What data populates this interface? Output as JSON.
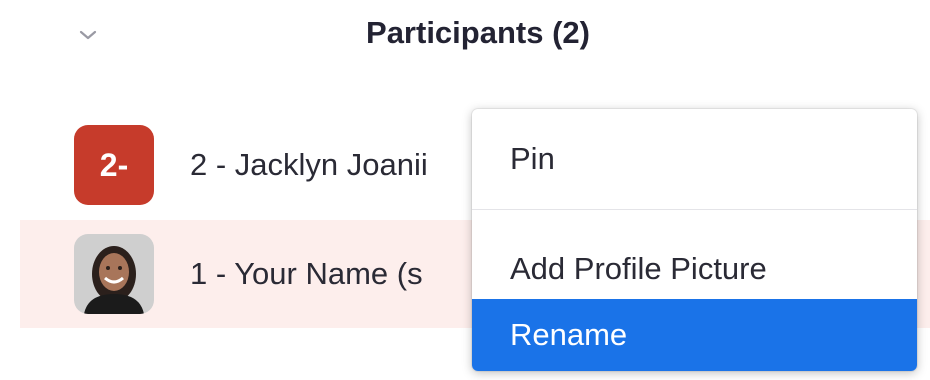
{
  "header": {
    "title": "Participants (2)",
    "collapse_icon": "chevron-down-icon"
  },
  "participants": [
    {
      "display_name": "2 - Jacklyn Joanii",
      "avatar_initials": "2-",
      "avatar_color": "#c63b2b"
    },
    {
      "display_name": "1 - Your Name (s",
      "avatar_icon": "person-photo-icon"
    }
  ],
  "context_menu": {
    "items": [
      {
        "label": "Pin"
      },
      {
        "label": "Add Profile Picture"
      },
      {
        "label": "Rename",
        "highlighted": true
      }
    ]
  },
  "colors": {
    "highlight": "#1a73e8",
    "row_hover": "#fdeeec",
    "avatar_red": "#c63b2b"
  }
}
